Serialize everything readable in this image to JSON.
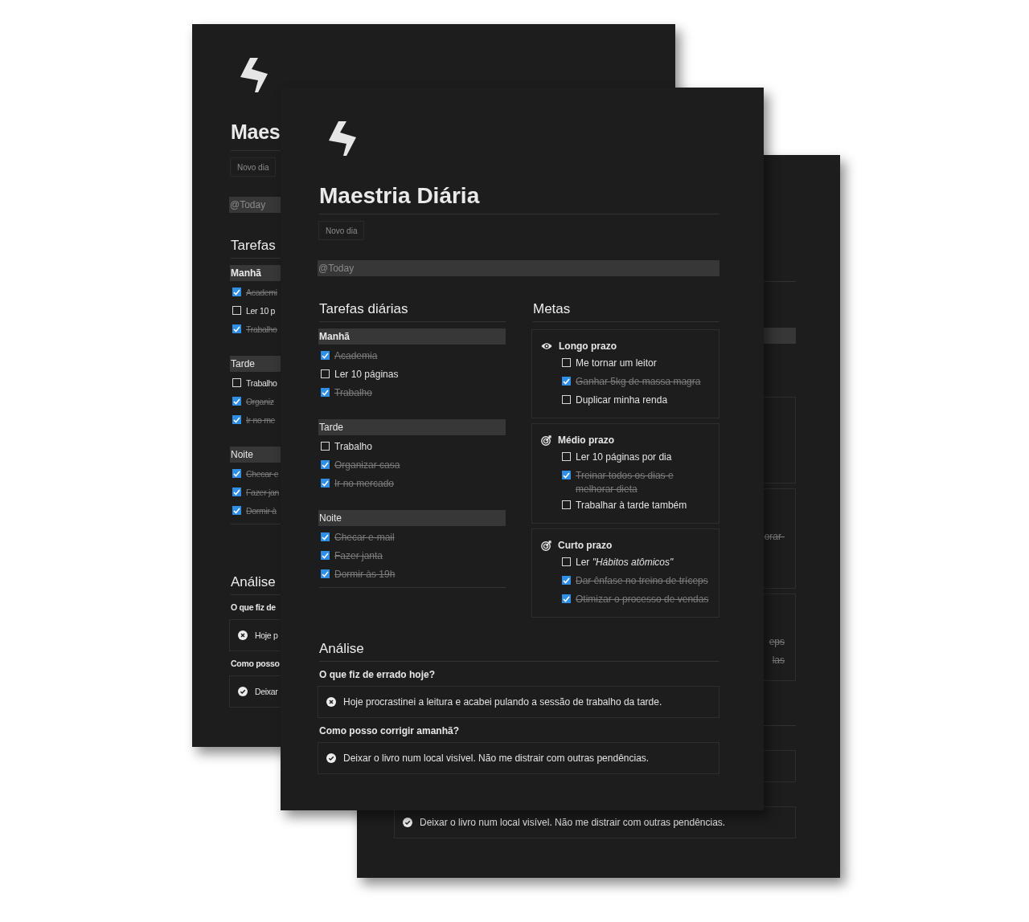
{
  "pages": [
    {
      "title": "Maes",
      "button": "Novo dia",
      "date_field": {
        "kind": "value",
        "value": "@Today"
      },
      "tasks": {
        "heading": "Tarefas",
        "groups": [
          {
            "name": "Manhã",
            "items": [
              {
                "text": "Academi",
                "done": true
              },
              {
                "text": "Ler 10 p",
                "done": false
              },
              {
                "text": "Trabalho",
                "done": true
              }
            ]
          },
          {
            "name": "Tarde",
            "items": [
              {
                "text": "Trabalho",
                "done": false
              },
              {
                "text": "Organiz",
                "done": true
              },
              {
                "text": "Ir no me",
                "done": true
              }
            ]
          },
          {
            "name": "Noite",
            "items": [
              {
                "text": "Checar e",
                "done": true
              },
              {
                "text": "Fazer jan",
                "done": true
              },
              {
                "text": "Dormir à",
                "done": true
              }
            ]
          }
        ]
      },
      "analysis": {
        "heading": "Análise",
        "entries": [
          {
            "kind": "answer",
            "question": "O que fiz de",
            "answer": "Hoje p",
            "ok": false
          },
          {
            "kind": "answer",
            "question": "Como posso",
            "answer": "Deixar",
            "ok": true
          }
        ]
      }
    },
    {
      "date_field": {
        "kind": "bar"
      },
      "goals": {
        "cards": [
          {
            "kind": "clipped"
          },
          {
            "kind": "clipped",
            "items": [
              {
                "text": "orar-",
                "done": true
              }
            ]
          },
          {
            "kind": "clipped",
            "items": [
              {
                "text": "eps",
                "done": true
              },
              {
                "text": "las",
                "done": true
              }
            ]
          }
        ]
      },
      "analysis": {
        "entries": [
          {
            "kind": "blank"
          },
          {
            "kind": "answer",
            "answer": "Deixar o livro num local visível. Não me distrair com outras pendências.",
            "ok": true
          }
        ]
      }
    },
    {
      "title": "Maestria Diária",
      "button": "Novo dia",
      "date_field": {
        "kind": "value",
        "value": "@Today"
      },
      "tasks": {
        "heading": "Tarefas diárias",
        "groups": [
          {
            "name": "Manhã",
            "items": [
              {
                "text": "Academia",
                "done": true
              },
              {
                "text": "Ler 10 páginas",
                "done": false
              },
              {
                "text": "Trabalho",
                "done": true
              }
            ]
          },
          {
            "name": "Tarde",
            "items": [
              {
                "text": "Trabalho",
                "done": false
              },
              {
                "text": "Organizar casa",
                "done": true
              },
              {
                "text": "Ir no mercado",
                "done": true
              }
            ]
          },
          {
            "name": "Noite",
            "items": [
              {
                "text": "Checar e-mail",
                "done": true
              },
              {
                "text": "Fazer janta",
                "done": true
              },
              {
                "text": "Dormir às 19h",
                "done": true
              }
            ]
          }
        ]
      },
      "goals": {
        "heading": "Metas",
        "cards": [
          {
            "kind": "full",
            "title": "Longo prazo",
            "items": [
              {
                "text": "Me tornar um leitor",
                "done": false
              },
              {
                "text": "Ganhar 5kg de massa magra",
                "done": true
              },
              {
                "text": "Duplicar minha renda",
                "done": false
              }
            ]
          },
          {
            "kind": "full",
            "title": "Médio prazo",
            "items": [
              {
                "text": "Ler 10 páginas por dia",
                "done": false
              },
              {
                "text": "Treinar todos os dias e melhorar dieta",
                "done": true
              },
              {
                "text": "Trabalhar à tarde também",
                "done": false
              }
            ]
          },
          {
            "kind": "full",
            "title": "Curto prazo",
            "items": [
              {
                "text": "Ler *\"Hábitos atômicos\"*",
                "done": false
              },
              {
                "text": "Dar ênfase no treino de tríceps",
                "done": true
              },
              {
                "text": "Otimizar o processo de vendas",
                "done": true
              }
            ]
          }
        ]
      },
      "analysis": {
        "heading": "Análise",
        "entries": [
          {
            "kind": "answer",
            "question": "O que fiz de errado hoje?",
            "answer": "Hoje procrastinei a leitura e acabei pulando a sessão de trabalho da tarde.",
            "ok": false
          },
          {
            "kind": "answer",
            "question": "Como posso corrigir amanhã?",
            "answer": "Deixar o livro num local visível. Não me distrair com outras pendências.",
            "ok": true
          }
        ]
      }
    }
  ]
}
